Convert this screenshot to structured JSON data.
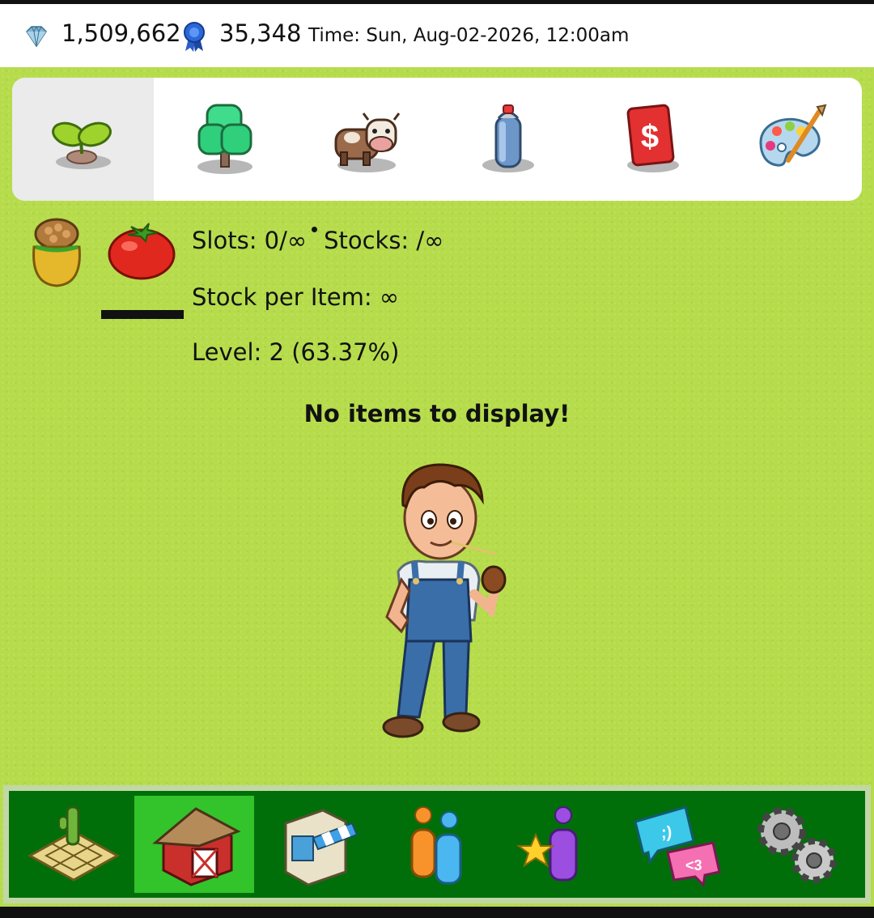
{
  "topbar": {
    "gems": "1,509,662",
    "gem_icon": "diamond-icon",
    "ribbons": "35,348",
    "ribbon_icon": "ribbon-icon",
    "time": "Time: Sun, Aug-02-2026, 12:00am"
  },
  "categories": [
    {
      "icon": "seedling-icon",
      "active": true
    },
    {
      "icon": "tree-icon",
      "active": false
    },
    {
      "icon": "cow-icon",
      "active": false
    },
    {
      "icon": "spray-can-icon",
      "active": false
    },
    {
      "icon": "dollar-card-icon",
      "active": false
    },
    {
      "icon": "paint-palette-icon",
      "active": false
    }
  ],
  "info": {
    "bag_icon": "seed-bag-icon",
    "item_icon": "tomato-icon",
    "slots": "Slots: 0/∞",
    "stocks": "Stocks: /∞",
    "stock_per_item": "Stock per Item: ∞",
    "level": "Level: 2 (63.37%)"
  },
  "empty_message": "No items to display!",
  "character": "farmer-character",
  "bottom_nav": [
    {
      "icon": "farm-field-icon",
      "active": false
    },
    {
      "icon": "barn-icon",
      "active": true
    },
    {
      "icon": "market-stall-icon",
      "active": false
    },
    {
      "icon": "friends-icon",
      "active": false
    },
    {
      "icon": "star-person-icon",
      "active": false
    },
    {
      "icon": "chat-bubbles-icon",
      "active": false
    },
    {
      "icon": "gears-icon",
      "active": false
    }
  ],
  "colors": {
    "grass": "#b6dc4c",
    "nav_bg": "#006f0a",
    "nav_active": "#33c32a",
    "cat_active": "#ebebeb"
  }
}
